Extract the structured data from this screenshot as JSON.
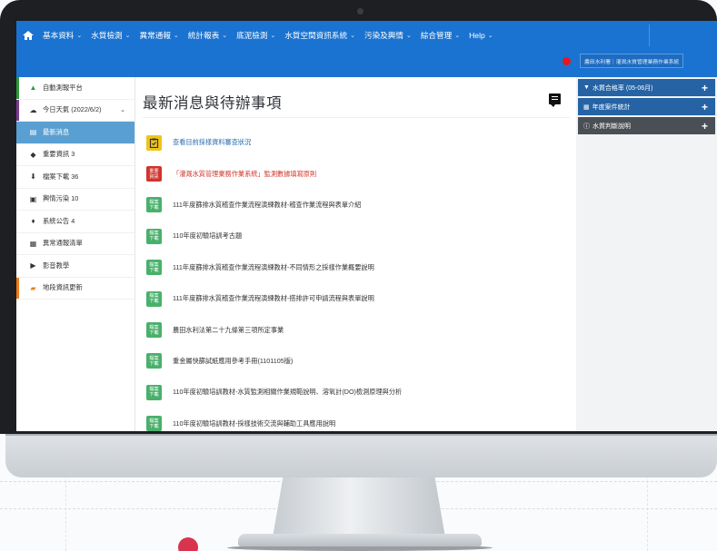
{
  "nav": {
    "items": [
      "基本資料",
      "水質檢測",
      "異常通報",
      "統計報表",
      "底泥檢測",
      "水質空間資訊系統",
      "污染及輿情",
      "綜合管理",
      "Help"
    ]
  },
  "status": {
    "org_badge": "農田水利署｜灌溉水質管理業務作業系統"
  },
  "sidebar": {
    "items": [
      {
        "label": "自動測報平台",
        "icon": "tree-icon",
        "color": "#2e9a3c"
      },
      {
        "label": "今日天氣 (2022/6/2)",
        "icon": "cloud-icon",
        "color": "#7a3b8f"
      },
      {
        "label": "最新消息",
        "icon": "message-icon",
        "color": "#5a9fd1"
      },
      {
        "label": "重要資訊 3",
        "icon": "tag-icon",
        "color": ""
      },
      {
        "label": "檔案下載 36",
        "icon": "download-icon",
        "color": ""
      },
      {
        "label": "輿情污染 10",
        "icon": "document-icon",
        "color": ""
      },
      {
        "label": "系統公告 4",
        "icon": "microphone-icon",
        "color": ""
      },
      {
        "label": "異常通報清單",
        "icon": "calendar-icon",
        "color": ""
      },
      {
        "label": "影音教學",
        "icon": "video-icon",
        "color": ""
      },
      {
        "label": "地段資訊更新",
        "icon": "inbox-icon",
        "color": "#f07d1a"
      }
    ]
  },
  "main": {
    "title": "最新消息與待辦事項",
    "news": [
      {
        "badge": "",
        "badge_type": "yellow",
        "text": "查看目前採樣資料審查狀況",
        "style": "link"
      },
      {
        "badge": "重要資訊",
        "badge_type": "red",
        "text": "「灌溉水質管理業務作業系統」監測數據填寫原則",
        "style": "alert"
      },
      {
        "badge": "檔案下載",
        "badge_type": "dl",
        "text": "111年度篩排水質稽查作業流程演練教材-稽查作業流程與表單介紹",
        "style": ""
      },
      {
        "badge": "檔案下載",
        "badge_type": "dl",
        "text": "110年度初驗培訓考古題",
        "style": ""
      },
      {
        "badge": "檔案下載",
        "badge_type": "dl",
        "text": "111年度篩排水質稽查作業流程演練教材-不同情形之採樣作業概要說明",
        "style": ""
      },
      {
        "badge": "檔案下載",
        "badge_type": "dl",
        "text": "111年度篩排水質稽查作業流程演練教材-搭排許可申請流程與表單說明",
        "style": ""
      },
      {
        "badge": "檔案下載",
        "badge_type": "dl",
        "text": "農田水利法第二十九條第三項所定事業",
        "style": ""
      },
      {
        "badge": "檔案下載",
        "badge_type": "dl",
        "text": "重金屬快篩試紙應用參考手冊(1101105版)",
        "style": ""
      },
      {
        "badge": "檔案下載",
        "badge_type": "dl",
        "text": "110年度初驗培訓教材-水質監測相關作業規範說明、溶氧計(DO)檢測原理與分析",
        "style": ""
      },
      {
        "badge": "檔案下載",
        "badge_type": "dl",
        "text": "110年度初驗培訓教材-採樣技術交流與輔助工具應用說明",
        "style": ""
      }
    ]
  },
  "rightpanel": {
    "items": [
      {
        "label": "水質合格率 (05-06月)",
        "icon": "filter-icon",
        "tone": "blue"
      },
      {
        "label": "年度案件統計",
        "icon": "table-icon",
        "tone": "blue"
      },
      {
        "label": "水質判斷說明",
        "icon": "info-icon",
        "tone": "gray"
      }
    ]
  },
  "colors": {
    "topbar": "#1a73d1",
    "active_sidebar": "#5a9fd1",
    "download_badge": "#49b06b",
    "alert": "#d0342c"
  }
}
